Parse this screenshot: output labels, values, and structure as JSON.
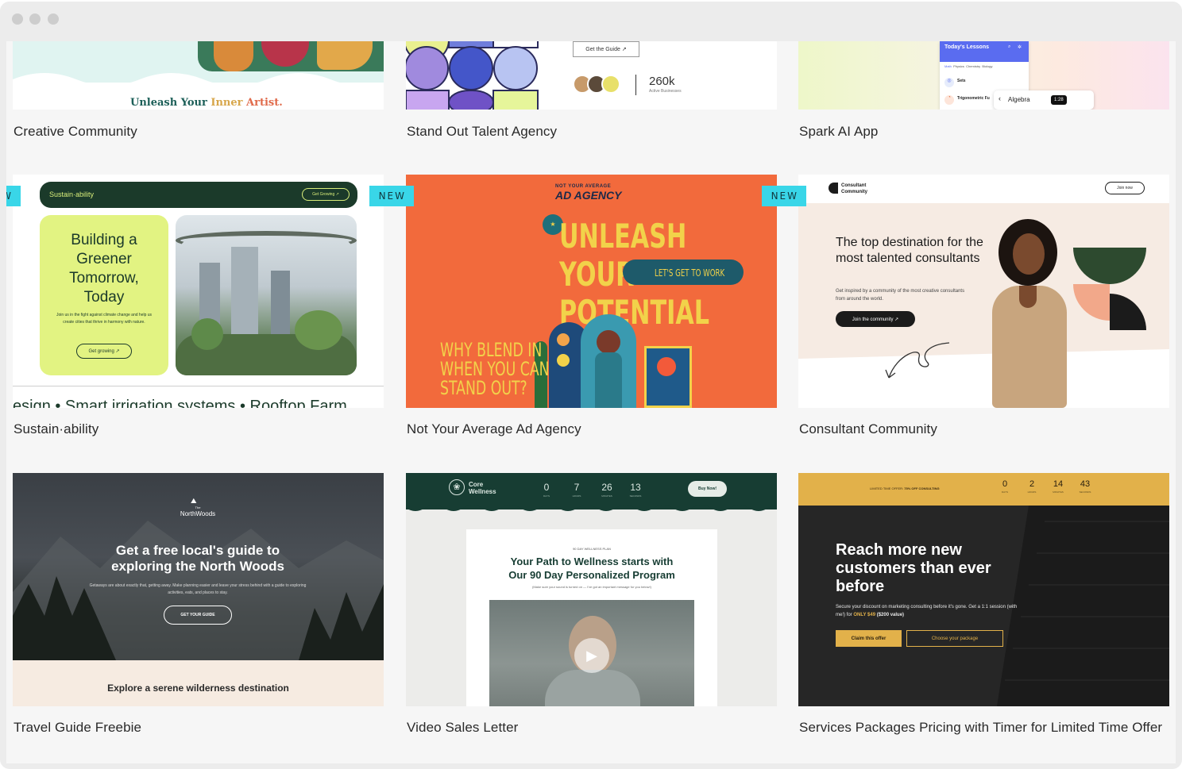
{
  "browser": {
    "controls": [
      "close",
      "minimize",
      "maximize"
    ]
  },
  "colors": {
    "badge": "#39d6e8",
    "orange": "#f26a3c",
    "forest": "#133f35",
    "gold": "#e2b14a"
  },
  "templates": [
    {
      "title": "Creative Community",
      "preview": {
        "tagline_a": "Unleash Your",
        "tagline_b": "Inner",
        "tagline_c": "Artist."
      }
    },
    {
      "title": "Stand Out Talent Agency",
      "preview": {
        "guide_button": "Get the Guide ↗",
        "stat_value": "260k",
        "stat_label": "Active Businesses"
      }
    },
    {
      "title": "Spark AI App",
      "preview": {
        "panel_title": "Today's Lessons",
        "subjects": [
          "Math",
          "Physics",
          "Chemistry",
          "Biology"
        ],
        "item_sets": "Sets",
        "item_trig": "Trigonometric Fu",
        "chip": "Algebra",
        "timer": "1:28"
      }
    },
    {
      "title": "Sustain·ability",
      "is_new": true,
      "preview": {
        "brand": "Sustain·ability",
        "nav_button": "Get Growing ↗",
        "headline": "Building a Greener Tomorrow, Today",
        "body": "Join us in the fight against climate change and help us create cities that thrive in harmony with nature.",
        "cta": "Get growing ↗",
        "ticker": "esign  •  Smart irrigation systems  •  Rooftop Farm"
      }
    },
    {
      "title": "Not Your Average Ad Agency",
      "is_new": true,
      "preview": {
        "brand_top": "NOT YOUR AVERAGE",
        "brand": "AD AGENCY",
        "line1": "UNLEASH",
        "line2": "YOUR",
        "line3": "POTENTIAL",
        "cta": "LET'S GET TO WORK",
        "sub1": "WHY BLEND IN",
        "sub2": "WHEN YOU CAN",
        "sub3": "STAND OUT?"
      }
    },
    {
      "title": "Consultant Community",
      "is_new": true,
      "preview": {
        "brand_a": "Consultant",
        "brand_b": "Community",
        "join_button": "Join now",
        "headline": "The top destination for the most talented consultants",
        "body": "Get inspired by a community of the most creative consultants from around the world.",
        "cta": "Join the community ↗"
      }
    },
    {
      "title": "Travel Guide Freebie",
      "preview": {
        "brand_small": "The",
        "brand": "NorthWoods",
        "headline": "Get a free local's guide to exploring the North Woods",
        "body": "Getaways are about exactly that, getting away. Make planning easier and leave your stress behind with a guide to exploring activities, eats, and places to stay.",
        "cta": "GET YOUR GUIDE",
        "footer": "Explore a serene wilderness destination"
      }
    },
    {
      "title": "Video Sales Letter",
      "preview": {
        "brand_a": "Core",
        "brand_b": "Wellness",
        "countdown": [
          "0",
          "7",
          "26",
          "13"
        ],
        "countdown_labels": [
          "DAYS",
          "HOURS",
          "MINUTES",
          "SECONDS"
        ],
        "buy_button": "Buy Now!",
        "eyebrow": "90 DAY WELLNESS PLAN",
        "headline_a": "Your Path to Wellness starts with",
        "headline_b": "Our 90 Day Personalized Program",
        "note": "(Make sure your sound is turned on — I've got an important message for you below!)"
      }
    },
    {
      "title": "Services Packages Pricing with Timer for Limited Time Offer",
      "preview": {
        "banner_a": "LIMITED TIME OFFER:",
        "banner_b": "75% OFF CONSULTING",
        "countdown": [
          "0",
          "2",
          "14",
          "43"
        ],
        "countdown_labels": [
          "DAYS",
          "HOURS",
          "MINUTES",
          "SECONDS"
        ],
        "headline": "Reach more new customers than ever before",
        "body_a": "Secure your discount on marketing consulting before it's gone. Get a 1:1 session (with me!) for",
        "body_b": "ONLY $49",
        "body_c": "($200 value)",
        "cta": "Claim this offer",
        "cta2": "Choose your package"
      }
    }
  ],
  "labels": {
    "new_badge": "NEW"
  }
}
